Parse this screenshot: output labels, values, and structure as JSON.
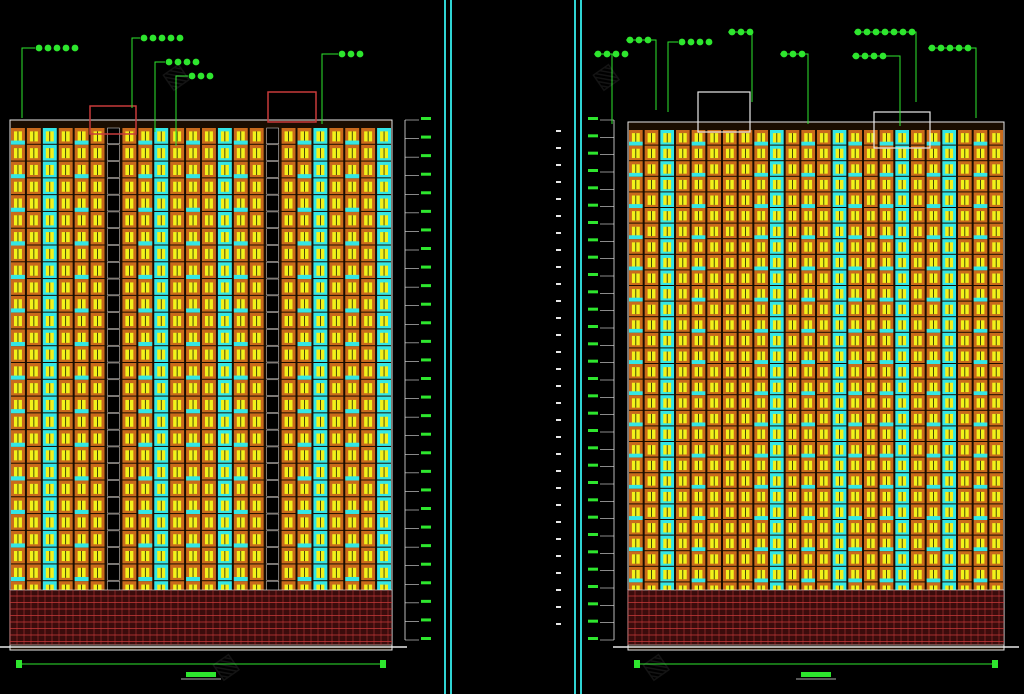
{
  "drawing": {
    "background": "#000000",
    "colors": {
      "frame_line": "#2fd4d4",
      "wall_orange": "#c96a1c",
      "balcony_cyan": "#33e6e6",
      "window_yellow": "#f2f21a",
      "annotation_green": "#2ee62e",
      "base_red": "#c83a3a",
      "white_line": "#e8e8e8"
    },
    "sheets": [
      {
        "name": "left-elevation"
      },
      {
        "name": "right-elevation"
      }
    ]
  }
}
